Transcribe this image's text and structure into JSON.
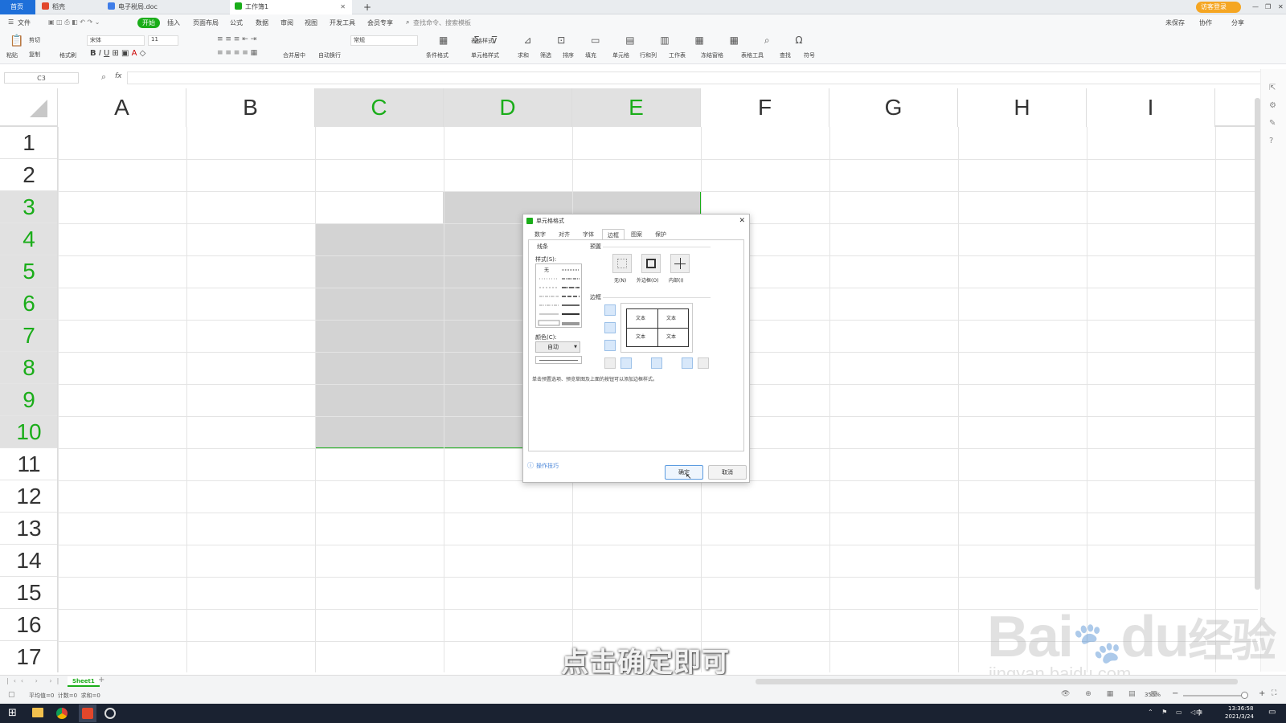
{
  "tabbar": {
    "home": "首页",
    "tabs": [
      {
        "label": "稻壳"
      },
      {
        "label": "电子税局.doc"
      },
      {
        "label": "工作簿1"
      }
    ],
    "new_tab": "+",
    "login": "访客登录"
  },
  "menu": {
    "file": "文件",
    "items": [
      "开始",
      "插入",
      "页面布局",
      "公式",
      "数据",
      "审阅",
      "视图",
      "开发工具",
      "会员专享"
    ],
    "search": "查找命令、搜索模板",
    "right": [
      "未保存",
      "协作",
      "分享"
    ]
  },
  "ribbon": {
    "paste": "粘贴",
    "cut": "剪切",
    "copy": "复制",
    "format_painter": "格式刷",
    "font": "宋体",
    "size": "11",
    "merge": "合并居中",
    "wrap": "自动换行",
    "number_format": "常规",
    "cond_format": "条件格式",
    "table_style": "表格样式",
    "cell_style": "单元格样式",
    "sum": "求和",
    "filter": "筛选",
    "sort": "排序",
    "fill": "填充",
    "cell": "单元格",
    "rowcol": "行和列",
    "sheet": "工作表",
    "freeze": "冻结窗格",
    "tools": "表格工具",
    "find": "查找",
    "symbol": "符号"
  },
  "formula_bar": {
    "name_box": "C3",
    "fx": "fx"
  },
  "grid": {
    "columns": [
      "A",
      "B",
      "C",
      "D",
      "E",
      "F",
      "G",
      "H",
      "I"
    ],
    "rows": [
      "1",
      "2",
      "3",
      "4",
      "5",
      "6",
      "7",
      "8",
      "9",
      "10",
      "11",
      "12",
      "13",
      "14",
      "15",
      "16",
      "17"
    ]
  },
  "dialog": {
    "title": "单元格格式",
    "tabs": [
      "数字",
      "对齐",
      "字体",
      "边框",
      "图案",
      "保护"
    ],
    "active_tab": "边框",
    "line_section": "线条",
    "style_label": "样式(S):",
    "style_none": "无",
    "color_label": "颜色(C):",
    "color_value": "自动",
    "preset_section": "预置",
    "presets": [
      "无(N)",
      "外边框(O)",
      "内部(I)"
    ],
    "border_section": "边框",
    "preview_text": [
      "文本",
      "文本",
      "文本",
      "文本"
    ],
    "hint": "单击预置选项、预览草图及上面的按钮可以添加边框样式。",
    "tips": "操作技巧",
    "ok": "确定",
    "cancel": "取消"
  },
  "sheetbar": {
    "sheet": "Sheet1",
    "add": "+"
  },
  "statusbar": {
    "stats": "平均值=0  计数=0  求和=0",
    "zoom": "355%"
  },
  "taskbar": {
    "time": "13:36:58",
    "date": "2021/3/24",
    "lang": "中"
  },
  "caption": "点击确定即可",
  "watermark": {
    "brand": "Bai",
    "brand2": "du",
    "cn": "经验",
    "url": "jingyan.baidu.com"
  },
  "colors": {
    "accent": "#1aad19",
    "selection": "#d3d3d3",
    "header_sel": "#e1e1e1"
  }
}
